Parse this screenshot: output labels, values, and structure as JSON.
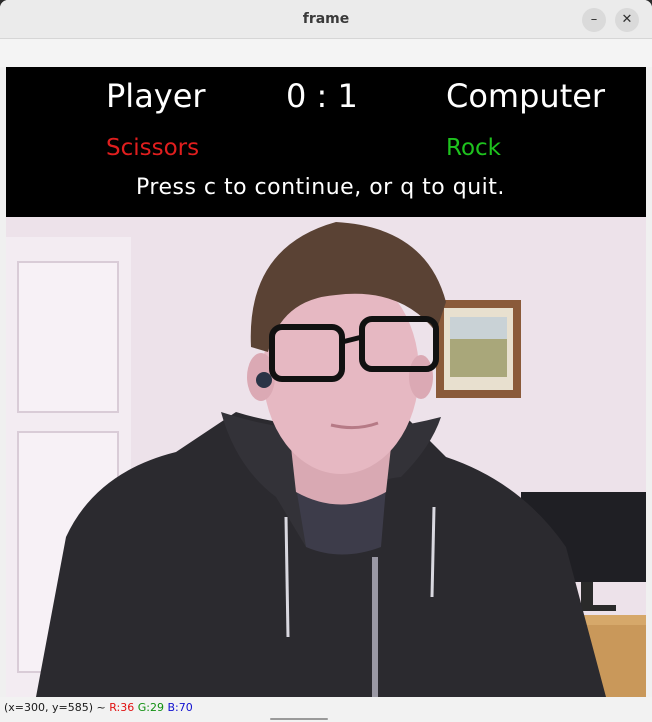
{
  "window": {
    "title": "frame",
    "minimize_glyph": "–",
    "close_glyph": "✕"
  },
  "hud": {
    "player_label": "Player",
    "score": "0 : 1",
    "computer_label": "Computer",
    "player_move": "Scissors",
    "computer_move": "Rock",
    "instructions": "Press c to continue, or q to quit.",
    "colors": {
      "player_move": "#e01e1e",
      "computer_move": "#1ec21e"
    }
  },
  "statusbar": {
    "coords": "(x=300, y=585) ~",
    "r": "R:36",
    "g": "G:29",
    "b": "B:70"
  }
}
